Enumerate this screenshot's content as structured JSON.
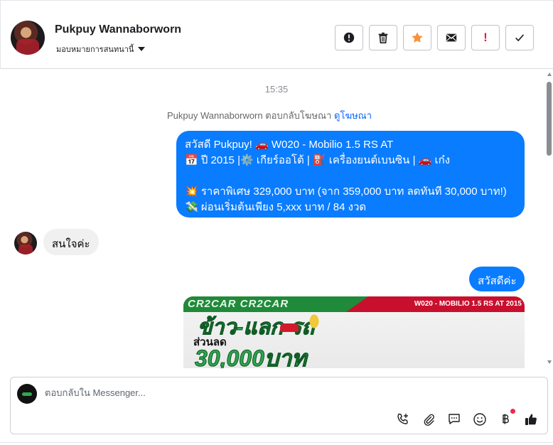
{
  "header": {
    "contact_name": "Pukpuy Wannaborworn",
    "assign_label": "มอบหมายการสนทนานี้",
    "actions": [
      {
        "icon": "alert-circle-icon",
        "name": "spam-button"
      },
      {
        "icon": "trash-icon",
        "name": "delete-button"
      },
      {
        "icon": "star-icon",
        "name": "star-button"
      },
      {
        "icon": "envelope-icon",
        "name": "mark-unread-button"
      },
      {
        "icon": "exclamation-icon",
        "name": "follow-up-button",
        "text": "!"
      },
      {
        "icon": "check-icon",
        "name": "done-button"
      }
    ]
  },
  "conversation": {
    "timestamp": "15:35",
    "system": {
      "text": "Pukpuy Wannaborworn ตอบกลับโฆษณา",
      "link": "ดูโฆษณา"
    },
    "outgoing_1": {
      "line1": "สวัสดี Pukpuy! 🚗 W020 - Mobilio 1.5 RS AT",
      "line2": "📅 ปี 2015 |⚙️ เกียร์ออโต้ | ⛽ เครื่องยนต์เบนซิน | 🚗 เก๋ง",
      "line3": "",
      "line4": "💥 ราคาพิเศษ 329,000 บาท (จาก 359,000 บาท ลดทันที 30,000 บาท!)",
      "line5": "💸 ผ่อนเริ่มต้นเพียง 5,xxx บาท / 84 งวด"
    },
    "incoming_1": "สนใจค่ะ",
    "outgoing_2": "สวัสดีค่ะ",
    "ad_image": {
      "brand": "CR2CAR CR2CAR",
      "model": "W020 - MOBILIO 1.5 RS AT 2015",
      "headline": "ข้าว-แลก-รถ",
      "sub": "ส่วนลด",
      "amount": "30,000บาท"
    }
  },
  "composer": {
    "placeholder": "ตอบกลับใน Messenger...",
    "tools": [
      "phone-plus-icon",
      "paperclip-icon",
      "chat-bubble-icon",
      "smile-icon",
      "baht-icon",
      "thumbs-up-icon"
    ]
  },
  "colors": {
    "accent": "#0a7cff",
    "star": "#f7923a",
    "danger": "#e41e3f",
    "link": "#0866ff"
  }
}
